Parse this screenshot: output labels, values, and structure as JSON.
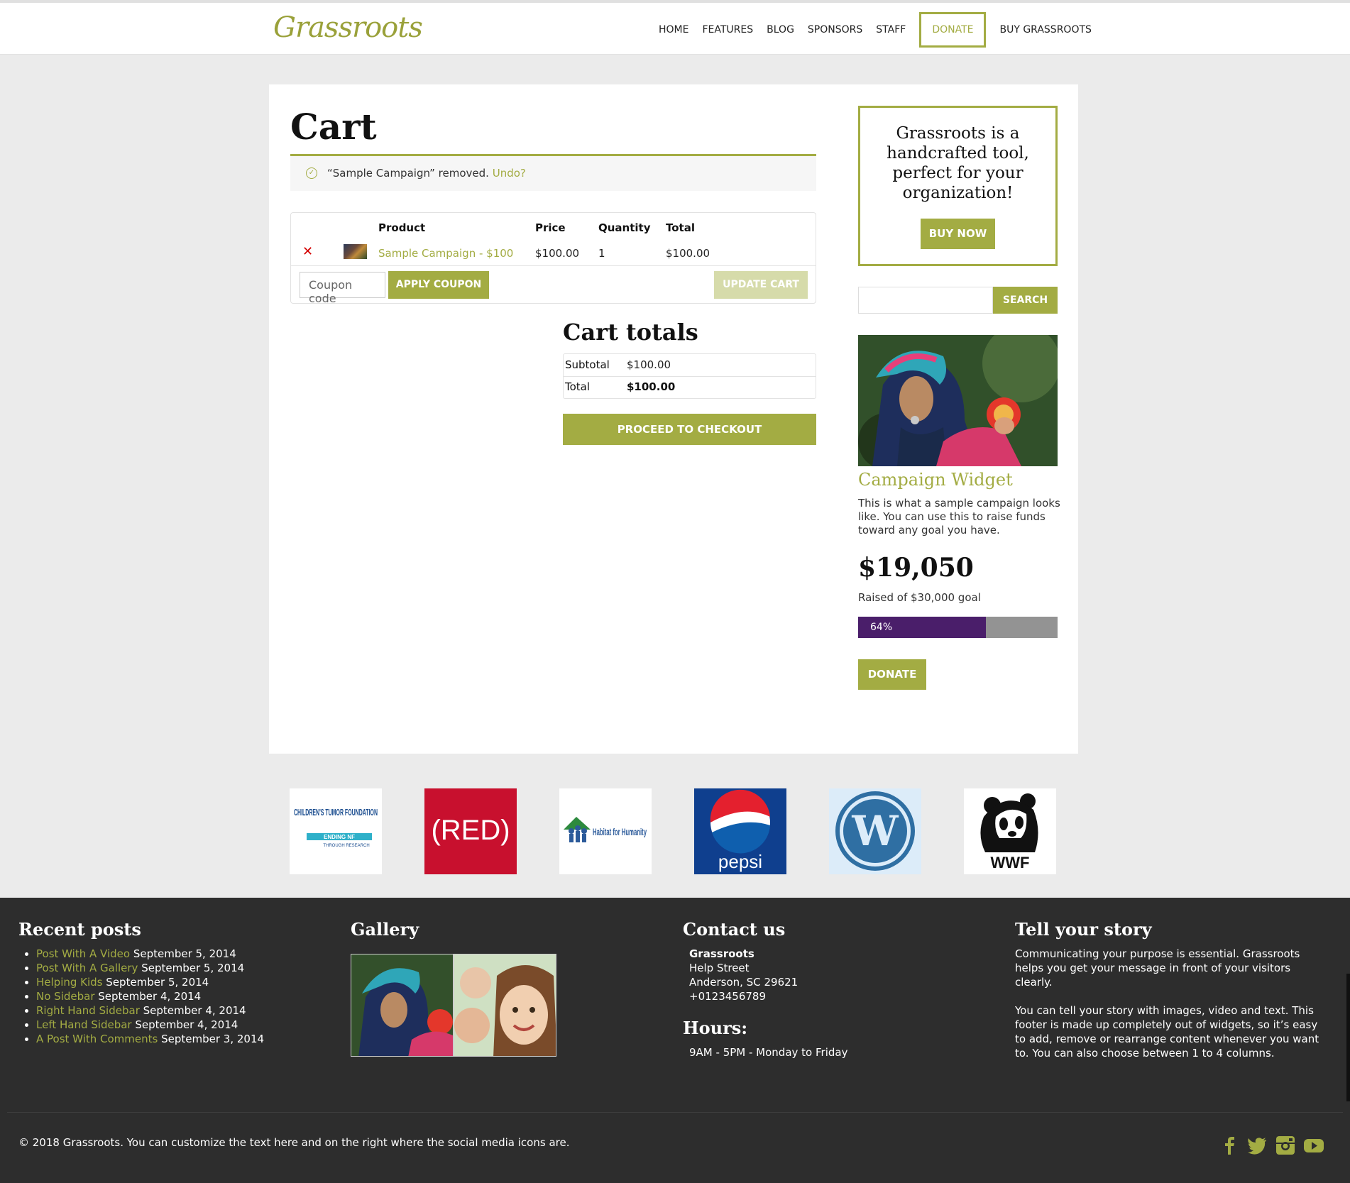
{
  "header": {
    "logo": "Grassroots",
    "nav": [
      "HOME",
      "FEATURES",
      "BLOG",
      "SPONSORS",
      "STAFF",
      "DONATE",
      "BUY GRASSROOTS"
    ]
  },
  "cart": {
    "title": "Cart",
    "notice": "“Sample Campaign” removed.",
    "undo": "Undo?",
    "headers": {
      "product": "Product",
      "price": "Price",
      "quantity": "Quantity",
      "total": "Total"
    },
    "item": {
      "product": "Sample Campaign - $100",
      "price": "$100.00",
      "quantity": "1",
      "total": "$100.00"
    },
    "coupon_placeholder": "Coupon code",
    "apply_coupon": "APPLY COUPON",
    "update_cart": "UPDATE CART"
  },
  "totals": {
    "title": "Cart totals",
    "subtotal_label": "Subtotal",
    "subtotal": "$100.00",
    "total_label": "Total",
    "total": "$100.00",
    "checkout": "PROCEED TO CHECKOUT"
  },
  "sidebar": {
    "promo": "Grassroots is a handcrafted tool, perfect for your organization!",
    "buy_now": "BUY NOW",
    "search": "SEARCH",
    "campaign_title": "Campaign Widget",
    "campaign_desc": "This is what a sample campaign looks like. You can use this to raise funds toward any goal you have.",
    "raised": "$19,050",
    "goal": "Raised of $30,000 goal",
    "progress_label": "64%",
    "progress": 0.64,
    "donate": "DONATE"
  },
  "sponsors": [
    "CHILDREN'S TUMOR FOUNDATION",
    "(RED)",
    "Habitat for Humanity",
    "pepsi",
    "WordPress",
    "WWF"
  ],
  "sponsor_sub": {
    "ctf": "ENDING NF",
    "ctf2": "THROUGH RESEARCH"
  },
  "footer": {
    "recent_title": "Recent posts",
    "posts": [
      {
        "title": "Post With A Video",
        "date": "September 5, 2014"
      },
      {
        "title": "Post With A Gallery",
        "date": "September 5, 2014"
      },
      {
        "title": "Helping Kids",
        "date": "September 5, 2014"
      },
      {
        "title": "No Sidebar",
        "date": "September 4, 2014"
      },
      {
        "title": "Right Hand Sidebar",
        "date": "September 4, 2014"
      },
      {
        "title": "Left Hand Sidebar",
        "date": "September 4, 2014"
      },
      {
        "title": "A Post With Comments",
        "date": "September 3, 2014"
      }
    ],
    "gallery_title": "Gallery",
    "contact_title": "Contact us",
    "contact": {
      "name": "Grassroots",
      "street": "Help Street",
      "city": "Anderson, SC 29621",
      "phone": "+0123456789"
    },
    "hours_title": "Hours:",
    "hours": "9AM - 5PM - Monday to Friday",
    "story_title": "Tell your story",
    "story_p1": "Communicating your purpose is essential. Grassroots helps you get your message in front of your visitors clearly.",
    "story_p2": "You can tell your story with images, video and text. This footer is made up completely out of widgets, so it’s easy to add, remove or rearrange content whenever you want to. You can also choose between 1 to 4 columns.",
    "copyright": "© 2018 Grassroots. You can customize the text here and on the right where the social media icons are."
  },
  "colors": {
    "accent": "#a3ac43",
    "progress": "#4a1e6a",
    "footer": "#2d2d2d"
  }
}
